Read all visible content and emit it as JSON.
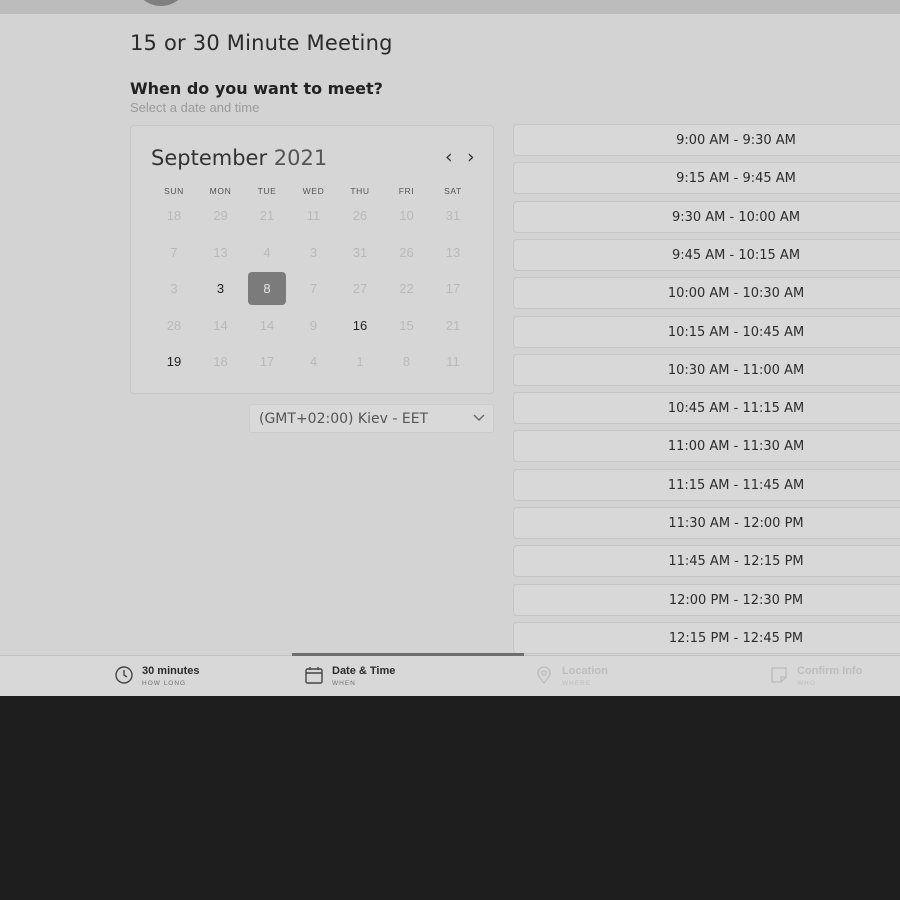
{
  "page": {
    "title": "15 or 30 Minute Meeting",
    "heading": "When do you want to meet?",
    "subheading": "Select a date and time"
  },
  "calendar": {
    "month": "September",
    "year": "2021",
    "prev_label": "‹",
    "next_label": "›",
    "weekdays": [
      "SUN",
      "MON",
      "TUE",
      "WED",
      "THU",
      "FRI",
      "SAT"
    ],
    "weeks": [
      [
        "18",
        "29",
        "21",
        "11",
        "26",
        "10",
        "31"
      ],
      [
        "7",
        "13",
        "4",
        "3",
        "31",
        "26",
        "13"
      ],
      [
        "3",
        "3",
        "8",
        "7",
        "27",
        "22",
        "17"
      ],
      [
        "28",
        "14",
        "14",
        "9",
        "16",
        "15",
        "21"
      ],
      [
        "19",
        "18",
        "17",
        "4",
        "1",
        "8",
        "11"
      ]
    ],
    "available_days": [
      "3",
      "16",
      "19"
    ],
    "selected_day": "8"
  },
  "timezone": {
    "label": "(GMT+02:00) Kiev - EET"
  },
  "time_slots": [
    "9:00 AM - 9:30 AM",
    "9:15 AM - 9:45 AM",
    "9:30 AM - 10:00 AM",
    "9:45 AM - 10:15 AM",
    "10:00 AM - 10:30 AM",
    "10:15 AM - 10:45 AM",
    "10:30 AM - 11:00 AM",
    "10:45 AM - 11:15 AM",
    "11:00 AM - 11:30 AM",
    "11:15 AM - 11:45 AM",
    "11:30 AM - 12:00 PM",
    "11:45 AM - 12:15 PM",
    "12:00 PM - 12:30 PM",
    "12:15 PM - 12:45 PM"
  ],
  "steps": [
    {
      "label": "30 minutes",
      "sub": "HOW LONG",
      "icon": "clock-icon",
      "state": "done"
    },
    {
      "label": "Date & Time",
      "sub": "WHEN",
      "icon": "calendar-icon",
      "state": "current"
    },
    {
      "label": "Location",
      "sub": "WHERE",
      "icon": "location-pin-icon",
      "state": "pending"
    },
    {
      "label": "Confirm Info",
      "sub": "WHO",
      "icon": "note-icon",
      "state": "pending"
    }
  ],
  "colors": {
    "app_background": "#d3d3d3",
    "outer_background": "#1e1e1e",
    "selected_day": "#7b7b7b"
  }
}
